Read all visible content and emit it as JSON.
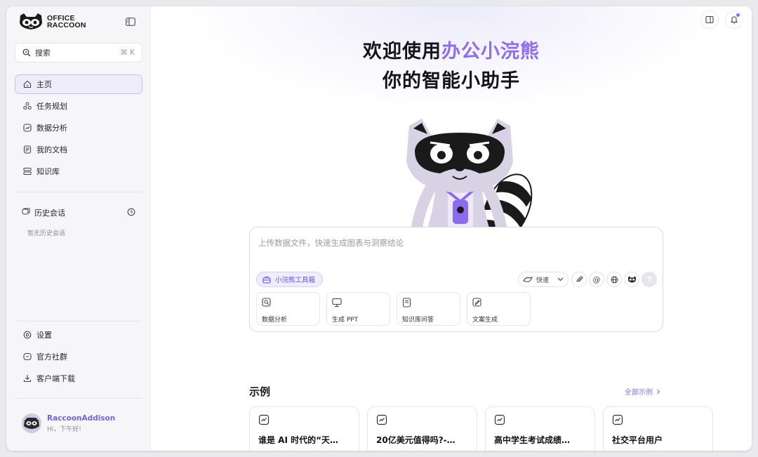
{
  "brand": {
    "line1": "OFFICE",
    "line2": "RACCOON",
    "logo_icon": "raccoon-logo-icon"
  },
  "sidebar": {
    "search": {
      "label": "搜索",
      "shortcut": "⌘ K"
    },
    "nav": [
      {
        "label": "主页",
        "icon": "home-icon",
        "active": true
      },
      {
        "label": "任务规划",
        "icon": "task-plan-icon"
      },
      {
        "label": "数据分析",
        "icon": "data-analysis-icon"
      },
      {
        "label": "我的文档",
        "icon": "document-icon"
      },
      {
        "label": "知识库",
        "icon": "knowledge-base-icon"
      }
    ],
    "history": {
      "label": "历史会话",
      "empty": "暂无历史会话"
    },
    "bottom": [
      {
        "label": "设置",
        "icon": "settings-icon"
      },
      {
        "label": "官方社群",
        "icon": "community-icon"
      },
      {
        "label": "客户端下载",
        "icon": "download-icon"
      }
    ],
    "user": {
      "name": "RaccoonAddison",
      "greeting": "Hi，下午好!"
    }
  },
  "hero": {
    "line1_prefix": "欢迎使用",
    "line1_accent": "办公小浣熊",
    "line2": "你的智能小助手"
  },
  "composer": {
    "placeholder": "上传数据文件，快速生成图表与洞察结论",
    "toolbox_label": "小浣熊工具箱",
    "mode_label": "快速",
    "quick_actions": [
      {
        "label": "数据分析",
        "icon": "data-analysis-icon"
      },
      {
        "label": "生成 PPT",
        "icon": "ppt-icon"
      },
      {
        "label": "知识库问答",
        "icon": "knowledge-qa-icon"
      },
      {
        "label": "文案生成",
        "icon": "copywriting-icon"
      }
    ]
  },
  "examples": {
    "title": "示例",
    "all_label": "全部示例",
    "cards": [
      {
        "title": "谁是 AI 时代的“天…"
      },
      {
        "title": "20亿美元值得吗?-…"
      },
      {
        "title": "高中学生考试成绩…"
      },
      {
        "title": "社交平台用户"
      }
    ]
  },
  "colors": {
    "accent": "#8e6bef",
    "active_bg": "#eeecfb"
  }
}
